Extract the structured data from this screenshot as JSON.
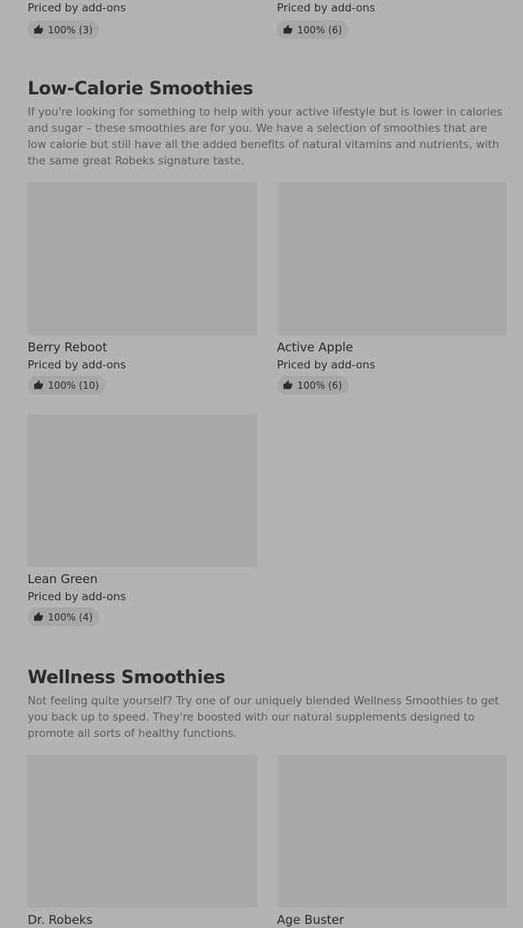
{
  "top_cards": [
    {
      "price": "Priced by add-ons",
      "rating": "100% (3)"
    },
    {
      "price": "Priced by add-ons",
      "rating": "100% (6)"
    }
  ],
  "sections": [
    {
      "title": "Low-Calorie Smoothies",
      "description": "If you're looking for something to help with your active lifestyle but is lower in calories and sugar – these smoothies are for you. We have a selection of smoothies that are low calorie but still have all the added benefits of natural vitamins and nutrients, with the same great Robeks signature taste.",
      "items": [
        {
          "name": "Berry Reboot",
          "price": "Priced by add-ons",
          "rating": "100% (10)"
        },
        {
          "name": "Active Apple",
          "price": "Priced by add-ons",
          "rating": "100% (6)"
        },
        {
          "name": "Lean Green",
          "price": "Priced by add-ons",
          "rating": "100% (4)"
        }
      ]
    },
    {
      "title": "Wellness Smoothies",
      "description": "Not feeling quite yourself? Try one of our uniquely blended Wellness Smoothies to get you back up to speed. They're boosted with our natural supplements designed to promote all sorts of healthy functions.",
      "items": [
        {
          "name": "Dr. Robeks"
        },
        {
          "name": "Age Buster"
        }
      ]
    }
  ],
  "icons": {
    "rating": "thumbs-up-icon"
  },
  "colors": {
    "background": "#b3b3b3",
    "image_placeholder": "#a9a9a9",
    "rating_pill": "#a7a7a7"
  }
}
